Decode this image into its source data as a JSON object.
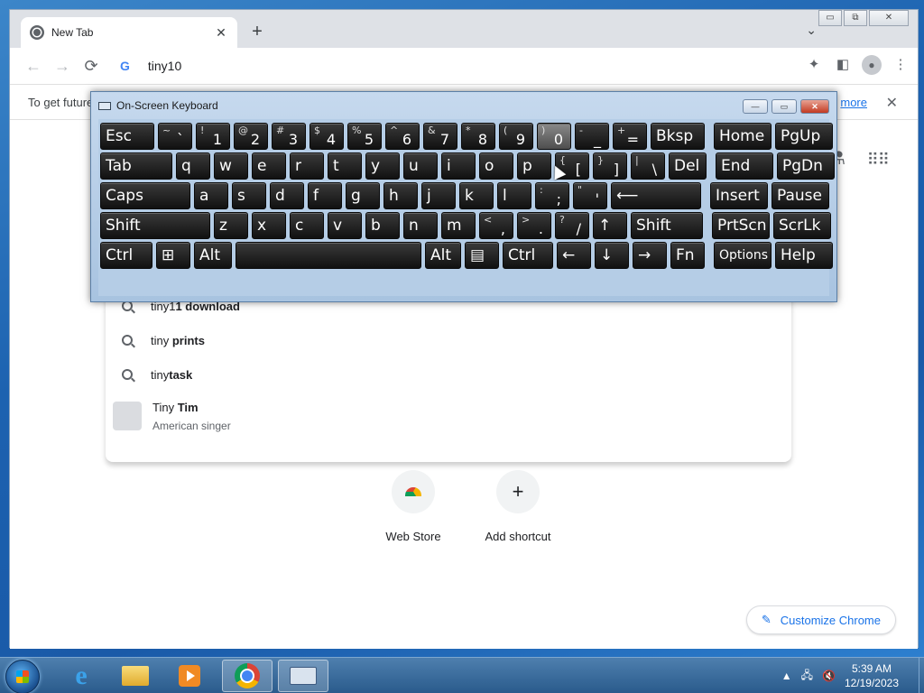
{
  "browser": {
    "tab_title": "New Tab",
    "tab_close": "✕",
    "new_tab": "+",
    "tab_search": "⌄",
    "window_controls": {
      "minimize": "▭",
      "restore": "⧉",
      "close": "✕"
    },
    "nav": {
      "back": "←",
      "forward": "→",
      "reload": "⟳"
    },
    "omnibox_text": "tiny10",
    "omnibox_logo": "G",
    "toolbar_icons": [
      "puzzle-icon",
      "side-panel-icon",
      "profile-icon",
      "menu-icon"
    ]
  },
  "infobar": {
    "text": "To get future",
    "link": "more",
    "close": "✕"
  },
  "suggestions": [
    {
      "prefix": "tiny1",
      "bold": "1 download"
    },
    {
      "prefix": "tiny",
      "bold": " prints"
    },
    {
      "prefix": "tiny",
      "bold": "task"
    },
    {
      "prefix": "Tiny",
      "bold": " Tim",
      "subtitle": "American singer"
    }
  ],
  "shortcuts": [
    {
      "label": "Web Store"
    },
    {
      "label": "Add shortcut",
      "glyph": "+"
    }
  ],
  "customize_label": "Customize Chrome",
  "osk": {
    "title": "On-Screen Keyboard",
    "controls": {
      "minimize": "—",
      "restore": "▭",
      "close": "✕"
    },
    "rows": [
      [
        {
          "m": "Esc"
        },
        {
          "s": "~",
          "l": "`"
        },
        {
          "s": "!",
          "l": "1"
        },
        {
          "s": "@",
          "l": "2"
        },
        {
          "s": "#",
          "l": "3"
        },
        {
          "s": "$",
          "l": "4"
        },
        {
          "s": "%",
          "l": "5"
        },
        {
          "s": "^",
          "l": "6"
        },
        {
          "s": "&",
          "l": "7"
        },
        {
          "s": "*",
          "l": "8"
        },
        {
          "s": "(",
          "l": "9"
        },
        {
          "s": ")",
          "l": "0"
        },
        {
          "s": "-",
          "l": "_"
        },
        {
          "s": "+",
          "l": "="
        },
        {
          "m": "Bksp"
        },
        {
          "m": "Home"
        },
        {
          "m": "PgUp"
        }
      ],
      [
        {
          "m": "Tab"
        },
        {
          "m": "q"
        },
        {
          "m": "w"
        },
        {
          "m": "e"
        },
        {
          "m": "r"
        },
        {
          "m": "t"
        },
        {
          "m": "y"
        },
        {
          "m": "u"
        },
        {
          "m": "i"
        },
        {
          "m": "o"
        },
        {
          "m": "p"
        },
        {
          "s": "{",
          "l": "["
        },
        {
          "s": "}",
          "l": "]"
        },
        {
          "s": "|",
          "l": "\\"
        },
        {
          "m": "Del"
        },
        {
          "m": "End"
        },
        {
          "m": "PgDn"
        }
      ],
      [
        {
          "m": "Caps"
        },
        {
          "m": "a"
        },
        {
          "m": "s"
        },
        {
          "m": "d"
        },
        {
          "m": "f"
        },
        {
          "m": "g"
        },
        {
          "m": "h"
        },
        {
          "m": "j"
        },
        {
          "m": "k"
        },
        {
          "m": "l"
        },
        {
          "s": ":",
          "l": ";"
        },
        {
          "s": "\"",
          "l": "'"
        },
        {
          "m": "⟵"
        },
        {
          "m": "Insert"
        },
        {
          "m": "Pause"
        }
      ],
      [
        {
          "m": "Shift"
        },
        {
          "m": "z"
        },
        {
          "m": "x"
        },
        {
          "m": "c"
        },
        {
          "m": "v"
        },
        {
          "m": "b"
        },
        {
          "m": "n"
        },
        {
          "m": "m"
        },
        {
          "s": "<",
          "l": ","
        },
        {
          "s": ">",
          "l": "."
        },
        {
          "s": "?",
          "l": "/"
        },
        {
          "m": "↑"
        },
        {
          "m": "Shift"
        },
        {
          "m": "PrtScn"
        },
        {
          "m": "ScrLk"
        }
      ],
      [
        {
          "m": "Ctrl"
        },
        {
          "m": "⊞"
        },
        {
          "m": "Alt"
        },
        {
          "m": ""
        },
        {
          "m": "Alt"
        },
        {
          "m": "▤"
        },
        {
          "m": "Ctrl"
        },
        {
          "m": "←"
        },
        {
          "m": "↓"
        },
        {
          "m": "→"
        },
        {
          "m": "Fn"
        },
        {
          "m": "Options"
        },
        {
          "m": "Help"
        }
      ]
    ]
  },
  "taskbar": {
    "apps": [
      "internet-explorer-icon",
      "file-explorer-icon",
      "media-player-icon",
      "chrome-icon",
      "on-screen-keyboard-icon"
    ],
    "time": "5:39 AM",
    "date": "12/19/2023"
  }
}
